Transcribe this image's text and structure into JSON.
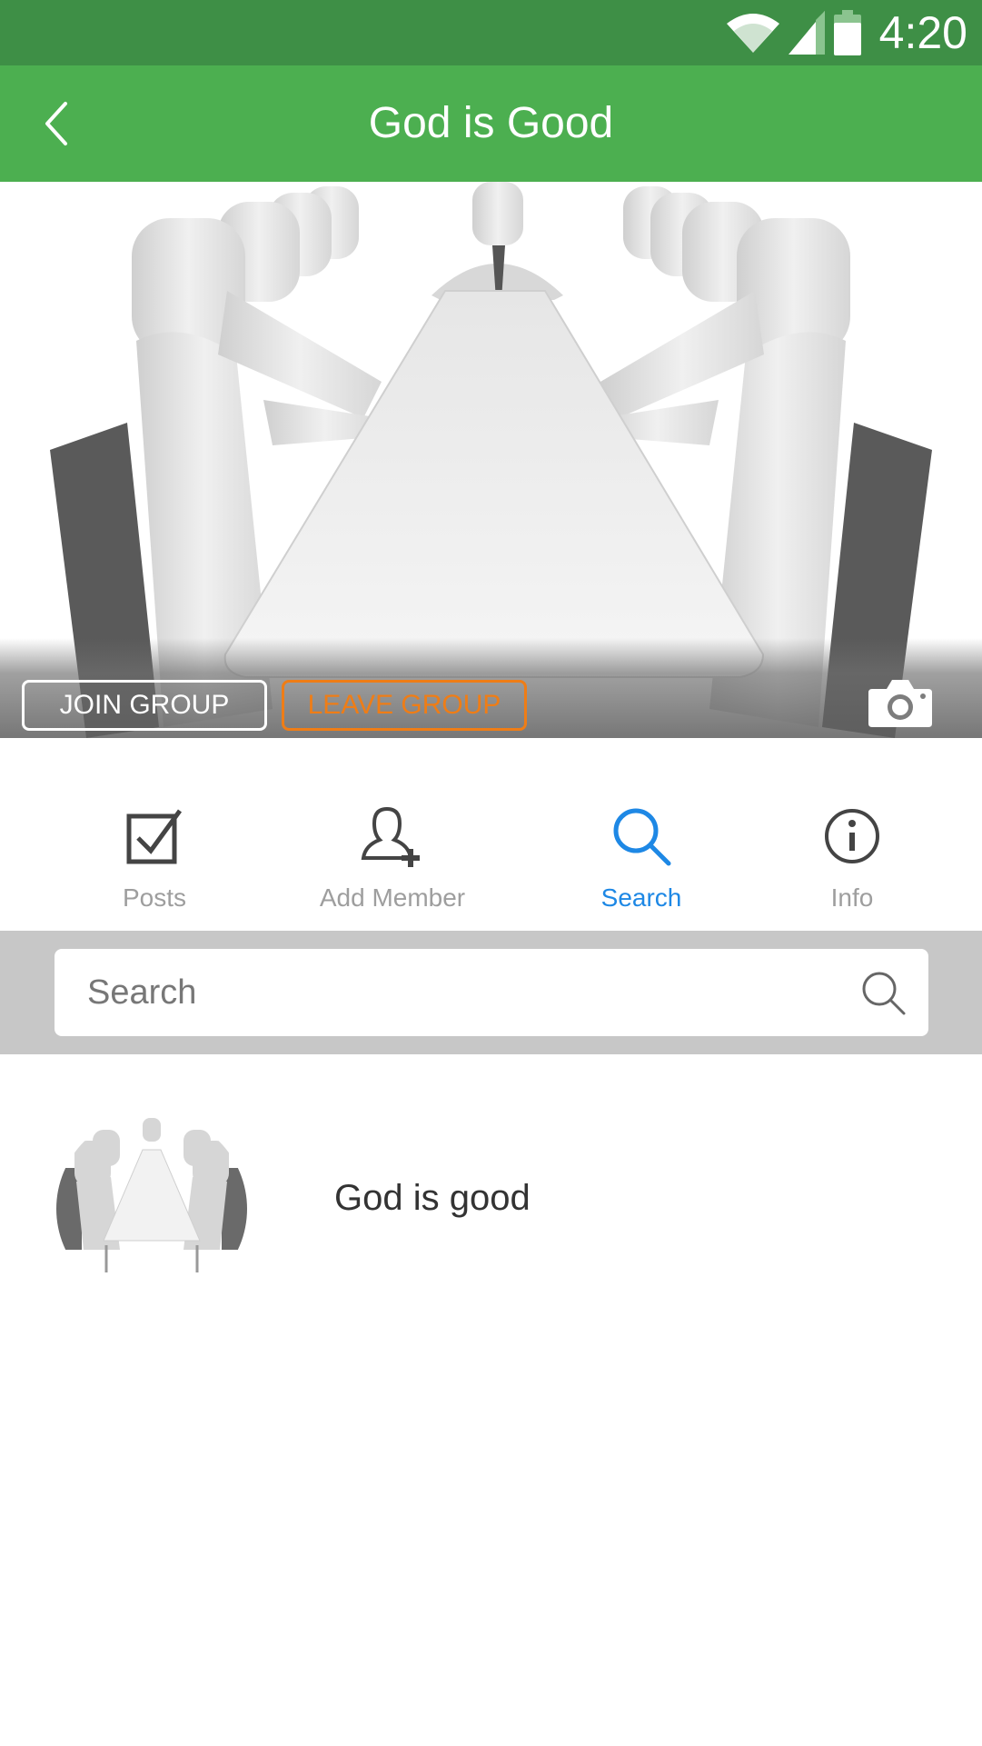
{
  "status_bar": {
    "time": "4:20",
    "icons": [
      "wifi-icon",
      "cellular-signal-icon",
      "battery-icon"
    ]
  },
  "app_bar": {
    "title": "God is Good",
    "back_icon": "chevron-left-icon"
  },
  "cover": {
    "image": "conference-table-figures",
    "join_label": "JOIN GROUP",
    "leave_label": "LEAVE GROUP",
    "camera_icon": "camera-icon"
  },
  "tabs": [
    {
      "label": "Posts",
      "icon": "checkbox-icon",
      "active": false
    },
    {
      "label": "Add Member",
      "icon": "add-user-icon",
      "active": false
    },
    {
      "label": "Search",
      "icon": "search-icon",
      "active": true
    },
    {
      "label": "Info",
      "icon": "info-icon",
      "active": false
    }
  ],
  "search": {
    "placeholder": "Search",
    "value": ""
  },
  "results": [
    {
      "name": "God is good",
      "avatar": "conference-table-figures"
    }
  ],
  "colors": {
    "status_bar": "#3e8f46",
    "app_bar": "#4caf50",
    "accent": "#1e88e5",
    "leave": "#ef7d16",
    "search_bg": "#c7c7c7"
  }
}
